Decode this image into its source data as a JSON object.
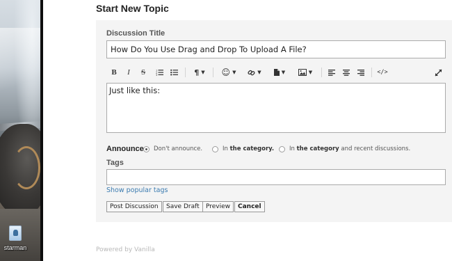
{
  "desktop": {
    "icon_label": "starman"
  },
  "page": {
    "title": "Start New Topic",
    "powered_by": "Powered by Vanilla"
  },
  "form": {
    "title_label": "Discussion Title",
    "title_value": "How Do You Use Drag and Drop To Upload A File?",
    "body_value": "Just like this:",
    "toolbar": [
      {
        "name": "bold-button",
        "glyph": "B"
      },
      {
        "name": "italic-button",
        "glyph": "I"
      },
      {
        "name": "strikethrough-button",
        "glyph": "S"
      },
      {
        "name": "ordered-list-button",
        "icon": "ordered-list-icon"
      },
      {
        "name": "unordered-list-button",
        "icon": "unordered-list-icon"
      },
      {
        "name": "paragraph-format-button",
        "glyph": "¶",
        "dropdown": true
      },
      {
        "name": "emoji-button",
        "glyph": "☺",
        "dropdown": true
      },
      {
        "name": "link-button",
        "icon": "link-icon",
        "dropdown": true
      },
      {
        "name": "file-button",
        "icon": "file-icon",
        "dropdown": true
      },
      {
        "name": "image-button",
        "icon": "image-icon",
        "dropdown": true
      },
      {
        "name": "align-left-button",
        "icon": "align-left-icon"
      },
      {
        "name": "align-center-button",
        "icon": "align-center-icon"
      },
      {
        "name": "align-right-button",
        "icon": "align-right-icon"
      },
      {
        "name": "source-code-button",
        "glyph": "</>"
      },
      {
        "name": "fullscreen-button",
        "icon": "expand-icon"
      }
    ],
    "announce": {
      "label": "Announce",
      "options": [
        {
          "text": "Don't announce.",
          "checked": true
        },
        {
          "prefix": "In ",
          "bold": "the category.",
          "suffix": "",
          "checked": false
        },
        {
          "prefix": "In ",
          "bold": "the category",
          "suffix": " and recent discussions.",
          "checked": false
        }
      ]
    },
    "tags_label": "Tags",
    "tags_value": "",
    "popular_tags_link": "Show popular tags",
    "buttons": {
      "post": "Post Discussion",
      "save_draft": "Save Draft",
      "preview": "Preview",
      "cancel": "Cancel"
    }
  },
  "colors": {
    "panel_bg": "#f4f4f4",
    "link": "#3b7bb0",
    "footer_text": "#b8b8b8"
  }
}
